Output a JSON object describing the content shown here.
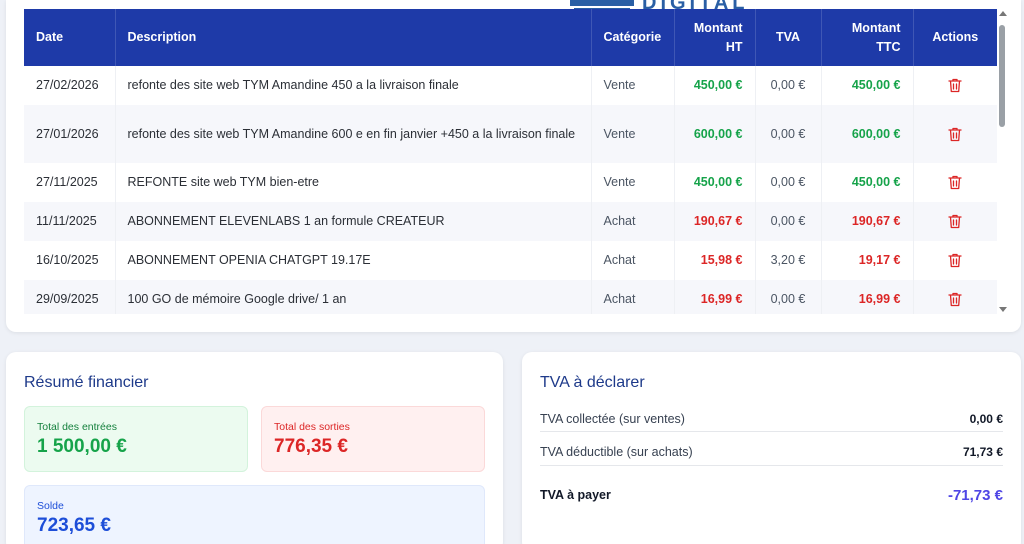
{
  "logo": {
    "text": "DIGITAL"
  },
  "table": {
    "headers": {
      "date": "Date",
      "description": "Description",
      "categorie": "Catégorie",
      "montant_ht_1": "Montant",
      "montant_ht_2": "HT",
      "tva": "TVA",
      "montant_ttc_1": "Montant",
      "montant_ttc_2": "TTC",
      "actions": "Actions"
    },
    "rows": [
      {
        "date": "27/02/2026",
        "description": "refonte des site web TYM Amandine 450 a la livraison finale",
        "categorie": "Vente",
        "ht": "450,00 €",
        "tva": "0,00 €",
        "ttc": "450,00 €",
        "type": "in"
      },
      {
        "date": "27/01/2026",
        "description": "refonte des site web TYM Amandine 600 e en fin janvier +450 a la livraison finale",
        "categorie": "Vente",
        "ht": "600,00 €",
        "tva": "0,00 €",
        "ttc": "600,00 €",
        "type": "in"
      },
      {
        "date": "27/11/2025",
        "description": "REFONTE site web TYM bien-etre",
        "categorie": "Vente",
        "ht": "450,00 €",
        "tva": "0,00 €",
        "ttc": "450,00 €",
        "type": "in"
      },
      {
        "date": "11/11/2025",
        "description": "ABONNEMENT ELEVENLABS 1 an formule CREATEUR",
        "categorie": "Achat",
        "ht": "190,67 €",
        "tva": "0,00 €",
        "ttc": "190,67 €",
        "type": "out"
      },
      {
        "date": "16/10/2025",
        "description": "ABONNEMENT OPENIA CHATGPT 19.17E",
        "categorie": "Achat",
        "ht": "15,98 €",
        "tva": "3,20 €",
        "ttc": "19,17 €",
        "type": "out"
      },
      {
        "date": "29/09/2025",
        "description": "100 GO de mémoire Google drive/ 1 an",
        "categorie": "Achat",
        "ht": "16,99 €",
        "tva": "0,00 €",
        "ttc": "16,99 €",
        "type": "out"
      }
    ]
  },
  "resume": {
    "title": "Résumé financier",
    "entrees_label": "Total des entrées",
    "entrees_value": "1 500,00 €",
    "sorties_label": "Total des sorties",
    "sorties_value": "776,35 €",
    "solde_label": "Solde",
    "solde_value": "723,65 €"
  },
  "tva_declare": {
    "title": "TVA à déclarer",
    "collectee_label": "TVA collectée (sur ventes)",
    "collectee_value": "0,00 €",
    "deductible_label": "TVA déductible (sur achats)",
    "deductible_value": "71,73 €",
    "payer_label": "TVA à payer",
    "payer_value": "-71,73 €"
  },
  "colors": {
    "header_bg": "#1e3aa8",
    "positive": "#16a34a",
    "negative": "#dc2626",
    "accent": "#4f46e5"
  },
  "icons": {
    "delete": "trash-icon"
  }
}
